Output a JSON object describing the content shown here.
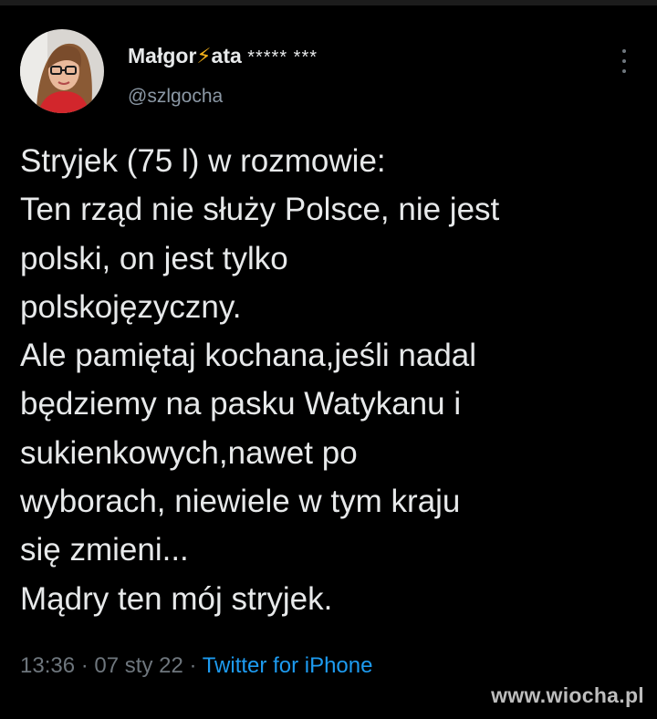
{
  "author": {
    "name_part1": "Małgor",
    "lightning": "⚡",
    "name_part2": "ata",
    "stars": "***** ***",
    "handle": "@szlgocha"
  },
  "tweet": {
    "lines": [
      "Stryjek (75 l) w rozmowie:",
      "Ten rząd nie służy Polsce, nie jest",
      "polski, on jest tylko",
      "polskojęzyczny.",
      "Ale pamiętaj kochana,jeśli nadal",
      "będziemy na pasku Watykanu i",
      "sukienkowych,nawet po",
      "wyborach, niewiele w tym kraju",
      "się zmieni...",
      "Mądry ten mój stryjek."
    ]
  },
  "meta": {
    "time": "13:36",
    "date": "07 sty 22",
    "separator": "·",
    "source": "Twitter for iPhone"
  },
  "watermark": "www.wiocha.pl",
  "colors": {
    "background": "#000000",
    "text": "#e7e9ea",
    "muted": "#6e767d",
    "link": "#1d9bf0",
    "lightning": "#f5b21a"
  }
}
